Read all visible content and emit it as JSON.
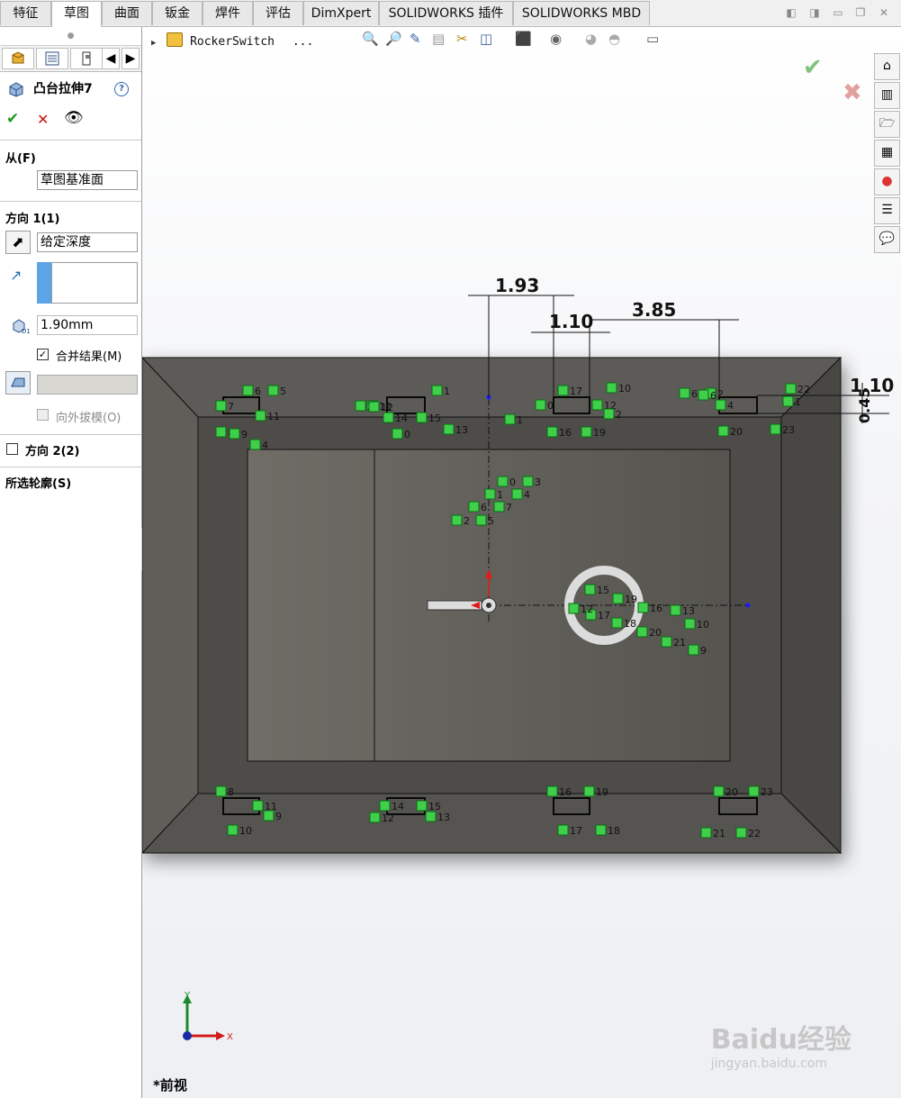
{
  "tabs": [
    "特征",
    "草图",
    "曲面",
    "钣金",
    "焊件",
    "评估",
    "DimXpert",
    "SOLIDWORKS 插件",
    "SOLIDWORKS MBD"
  ],
  "active_tab": "草图",
  "panel": {
    "title": "凸台拉伸7",
    "from_label": "从(F)",
    "from_value": "草图基准面",
    "direction1_label": "方向 1(1)",
    "end_condition": "给定深度",
    "depth": "1.90mm",
    "merge_label": "合并结果(M)",
    "merge_checked": true,
    "draft_label": "向外拔模(O)",
    "direction2_label": "方向 2(2)",
    "contours_label": "所选轮廓(S)"
  },
  "viewport": {
    "breadcrumb": "RockerSwitch",
    "breadcrumb_more": "...",
    "view_name": "*前视",
    "dimensions": [
      "1.93",
      "1.10",
      "3.85",
      "1.10",
      "0.45"
    ],
    "axis_x": "X",
    "axis_y": "Y",
    "watermark": "Baidu经验",
    "watermark_url": "jingyan.baidu.com"
  },
  "relation_labels": [
    [
      "6",
      "5",
      "7",
      "12",
      "11",
      "4",
      "8",
      "9",
      "2",
      "1",
      "12",
      "14",
      "15",
      "13",
      "0"
    ],
    [
      "0",
      "3",
      "1",
      "4",
      "6",
      "7",
      "2",
      "5"
    ],
    [
      "17",
      "10",
      "12",
      "2",
      "16",
      "19",
      "1",
      "0"
    ],
    [
      "6",
      "2",
      "22",
      "1",
      "23",
      "20",
      "4",
      "6"
    ],
    [
      "15",
      "19",
      "16",
      "13",
      "10",
      "17",
      "18",
      "20",
      "21",
      "9",
      "12"
    ],
    [
      "8",
      "11",
      "9",
      "10",
      "14",
      "15",
      "12",
      "13",
      "16",
      "19",
      "17",
      "18",
      "20",
      "23",
      "21",
      "22"
    ]
  ]
}
